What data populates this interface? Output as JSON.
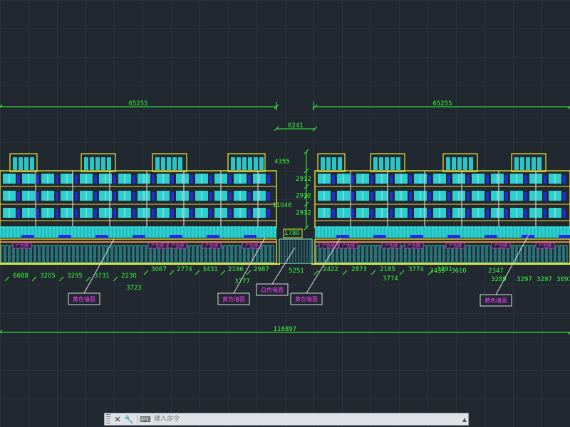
{
  "drawing": {
    "dimensions_top": [
      "65255",
      "65255"
    ],
    "gap_dimension": "6241",
    "height_dimensions": [
      "4355",
      "2912",
      "2912",
      "11046",
      "2912",
      "1780"
    ],
    "total_dimension": "116897",
    "bottom_dims_left": [
      "6688",
      "3205",
      "3295",
      "3731",
      "2230",
      "3723"
    ],
    "bottom_dims_middle": [
      "3067",
      "2774",
      "3431",
      "2196",
      "2987",
      "3777",
      "5251"
    ],
    "bottom_dims_right": [
      "2422",
      "2873",
      "2185",
      "3774",
      "3291",
      "3435",
      "3610",
      "2347",
      "3289",
      "3297",
      "3297",
      "3691"
    ],
    "callouts": [
      "黄色墙面",
      "黄色墙面",
      "白色墙面",
      "黄色墙面",
      "黄色墙面"
    ],
    "sign_label": "广告牌"
  },
  "colors": {
    "background": "#212830",
    "dimension": "#39ff3c",
    "building_outline": "#e8e83a",
    "window": "#2de0e0",
    "accent": "#ff3cff",
    "blue": "#1f2de0"
  },
  "command_line": {
    "placeholder": "键入命令",
    "close_icon": "close-icon",
    "settings_icon": "wrench-icon"
  }
}
